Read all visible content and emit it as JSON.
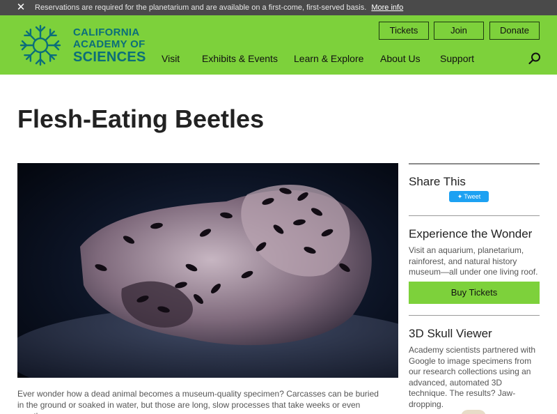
{
  "notice": {
    "close_icon": "close-icon",
    "message": "Reservations are required for the planetarium and are available on a first-come, first-served basis.",
    "more_link": "More info"
  },
  "header": {
    "logo": {
      "line1": "CALIFORNIA",
      "line2": "ACADEMY OF",
      "line3": "SCIENCES"
    },
    "buttons": {
      "tickets": "Tickets",
      "join": "Join",
      "donate": "Donate"
    },
    "nav": [
      "Visit",
      "Exhibits & Events",
      "Learn & Explore",
      "About Us",
      "Support"
    ],
    "search_icon": "search-icon"
  },
  "page": {
    "title": "Flesh-Eating Beetles",
    "hero_alt": "",
    "body": "Ever wonder how a dead animal becomes a museum-quality specimen? Carcasses can be buried in the ground or soaked in water, but those are long, slow processes that take weeks or even months."
  },
  "sidebar": {
    "share_title": "Share This",
    "tweet_label": "Tweet",
    "experience": {
      "title": "Experience the Wonder",
      "text": "Visit an aquarium, planetarium, rainforest, and natural history museum—all under one living roof.",
      "button": "Buy Tickets"
    },
    "skull": {
      "title": "3D Skull Viewer",
      "text": "Academy scientists partnered with Google to image specimens from our research collections using an advanced, automated 3D technique. The results? Jaw-dropping."
    }
  },
  "colors": {
    "brand_green": "#7dd13b",
    "logo_teal": "#0b6e7a",
    "notice_bg": "#4a4a4a",
    "tweet_blue": "#1da1f2"
  }
}
